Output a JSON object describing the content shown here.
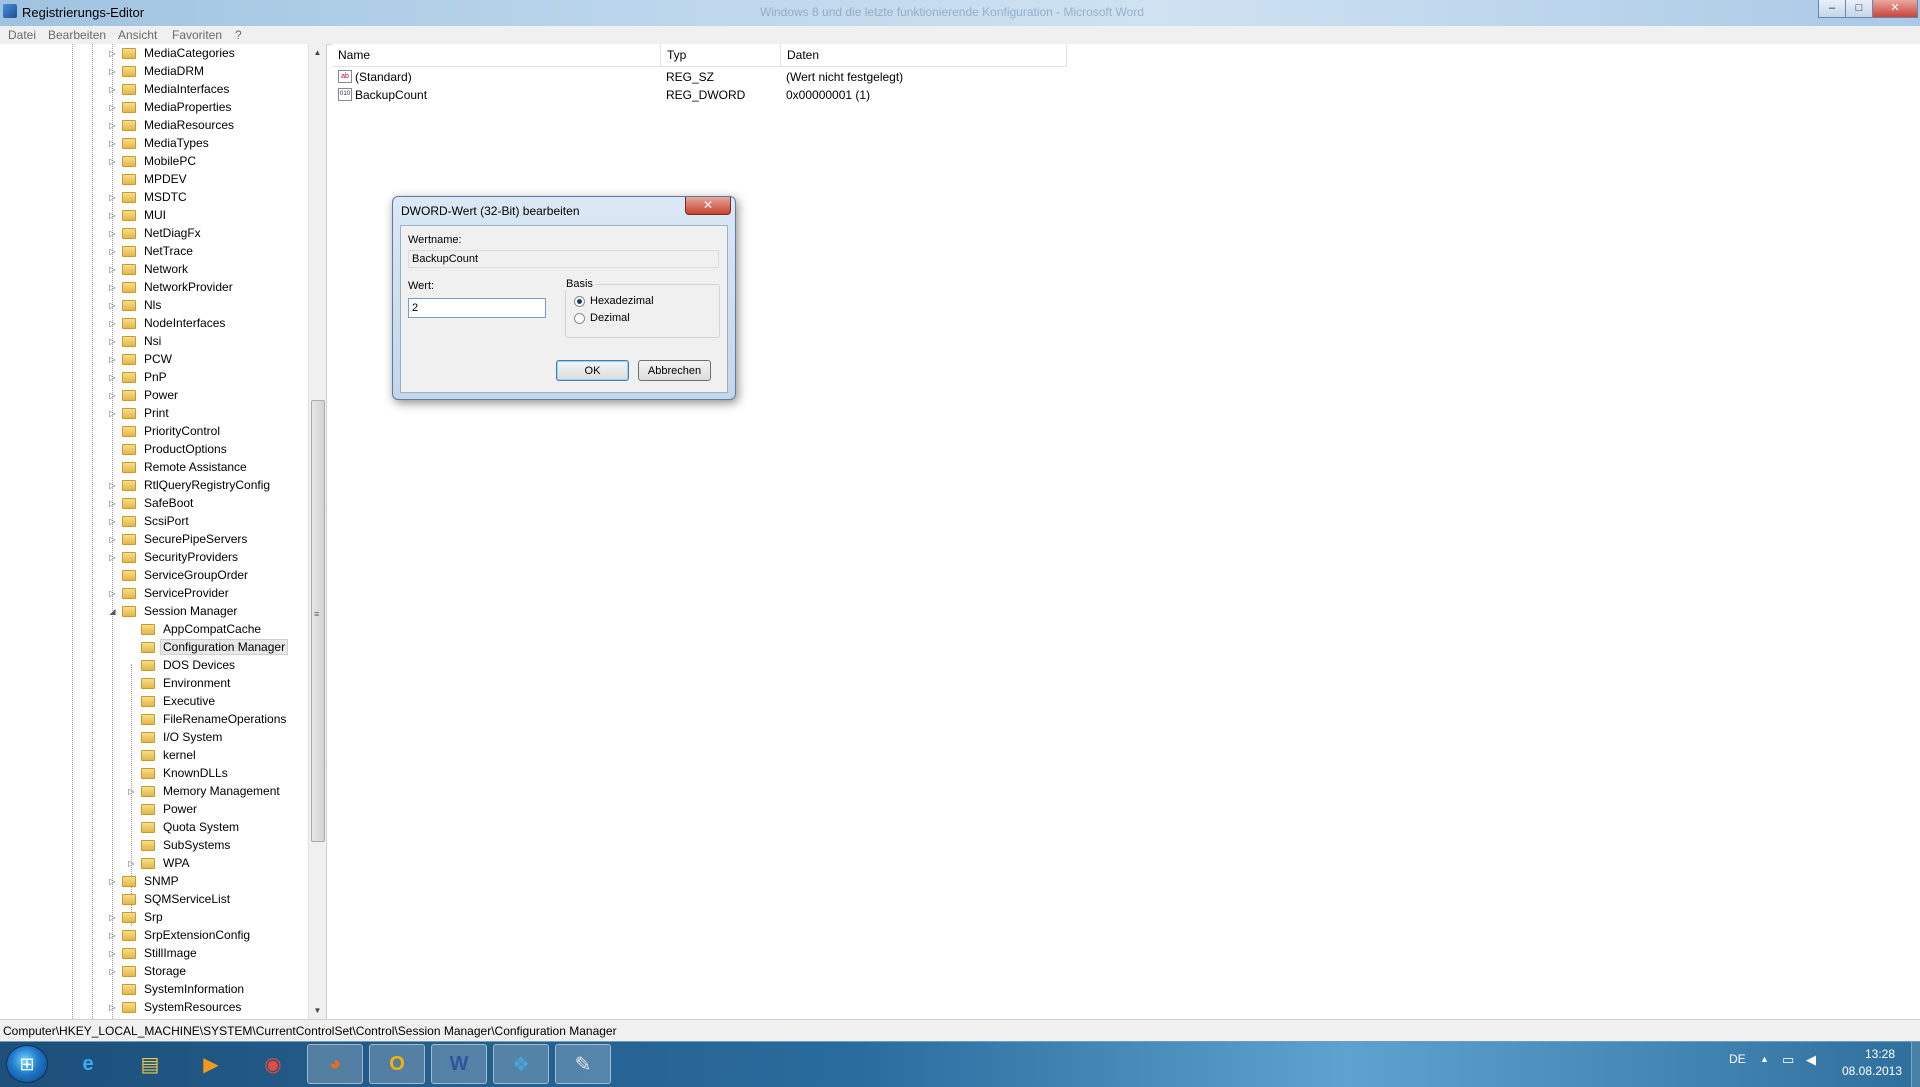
{
  "window": {
    "title": "Registrierungs-Editor",
    "ghost_title": "Windows 8 und die letzte funktionierende Konfiguration - Microsoft Word",
    "minimize": "–",
    "maximize": "□",
    "close": "✕"
  },
  "menu": [
    "Datei",
    "Bearbeiten",
    "Ansicht",
    "Favoriten",
    "?"
  ],
  "tree": {
    "level1": [
      {
        "label": "MediaCategories",
        "expand": "▷"
      },
      {
        "label": "MediaDRM",
        "expand": "▷"
      },
      {
        "label": "MediaInterfaces",
        "expand": "▷"
      },
      {
        "label": "MediaProperties",
        "expand": "▷"
      },
      {
        "label": "MediaResources",
        "expand": "▷"
      },
      {
        "label": "MediaTypes",
        "expand": "▷"
      },
      {
        "label": "MobilePC",
        "expand": "▷"
      },
      {
        "label": "MPDEV",
        "expand": ""
      },
      {
        "label": "MSDTC",
        "expand": "▷"
      },
      {
        "label": "MUI",
        "expand": "▷"
      },
      {
        "label": "NetDiagFx",
        "expand": "▷"
      },
      {
        "label": "NetTrace",
        "expand": "▷"
      },
      {
        "label": "Network",
        "expand": "▷"
      },
      {
        "label": "NetworkProvider",
        "expand": "▷"
      },
      {
        "label": "Nls",
        "expand": "▷"
      },
      {
        "label": "NodeInterfaces",
        "expand": "▷"
      },
      {
        "label": "Nsi",
        "expand": "▷"
      },
      {
        "label": "PCW",
        "expand": "▷"
      },
      {
        "label": "PnP",
        "expand": "▷"
      },
      {
        "label": "Power",
        "expand": "▷"
      },
      {
        "label": "Print",
        "expand": "▷"
      },
      {
        "label": "PriorityControl",
        "expand": ""
      },
      {
        "label": "ProductOptions",
        "expand": ""
      },
      {
        "label": "Remote Assistance",
        "expand": ""
      },
      {
        "label": "RtlQueryRegistryConfig",
        "expand": "▷"
      },
      {
        "label": "SafeBoot",
        "expand": "▷"
      },
      {
        "label": "ScsiPort",
        "expand": "▷"
      },
      {
        "label": "SecurePipeServers",
        "expand": "▷"
      },
      {
        "label": "SecurityProviders",
        "expand": "▷"
      },
      {
        "label": "ServiceGroupOrder",
        "expand": ""
      },
      {
        "label": "ServiceProvider",
        "expand": "▷"
      },
      {
        "label": "Session Manager",
        "expand": "◢"
      }
    ],
    "level2": [
      {
        "label": "AppCompatCache",
        "expand": ""
      },
      {
        "label": "Configuration Manager",
        "expand": ""
      },
      {
        "label": "DOS Devices",
        "expand": ""
      },
      {
        "label": "Environment",
        "expand": ""
      },
      {
        "label": "Executive",
        "expand": ""
      },
      {
        "label": "FileRenameOperations",
        "expand": ""
      },
      {
        "label": "I/O System",
        "expand": ""
      },
      {
        "label": "kernel",
        "expand": ""
      },
      {
        "label": "KnownDLLs",
        "expand": ""
      },
      {
        "label": "Memory Management",
        "expand": "▷"
      },
      {
        "label": "Power",
        "expand": ""
      },
      {
        "label": "Quota System",
        "expand": ""
      },
      {
        "label": "SubSystems",
        "expand": ""
      },
      {
        "label": "WPA",
        "expand": "▷"
      }
    ],
    "level1_after": [
      {
        "label": "SNMP",
        "expand": "▷"
      },
      {
        "label": "SQMServiceList",
        "expand": ""
      },
      {
        "label": "Srp",
        "expand": "▷"
      },
      {
        "label": "SrpExtensionConfig",
        "expand": "▷"
      },
      {
        "label": "StillImage",
        "expand": "▷"
      },
      {
        "label": "Storage",
        "expand": "▷"
      },
      {
        "label": "SystemInformation",
        "expand": ""
      },
      {
        "label": "SystemResources",
        "expand": "▷"
      }
    ],
    "selected": "Configuration Manager",
    "scroll_up": "▲",
    "scroll_down": "▼",
    "scroll_grip": "≡"
  },
  "values": {
    "headers": {
      "name": "Name",
      "type": "Typ",
      "data": "Daten"
    },
    "rows": [
      {
        "icon": "ab",
        "name": "(Standard)",
        "type": "REG_SZ",
        "data": "(Wert nicht festgelegt)"
      },
      {
        "icon": "010",
        "name": "BackupCount",
        "type": "REG_DWORD",
        "data": "0x00000001 (1)"
      }
    ]
  },
  "dialog": {
    "title": "DWORD-Wert (32-Bit) bearbeiten",
    "close": "✕",
    "wertname_label": "Wertname:",
    "wertname_value": "BackupCount",
    "wert_label": "Wert:",
    "wert_value": "2",
    "basis_label": "Basis",
    "hex_label": "Hexadezimal",
    "dec_label": "Dezimal",
    "ok": "OK",
    "cancel": "Abbrechen"
  },
  "status": {
    "path": "Computer\\HKEY_LOCAL_MACHINE\\SYSTEM\\CurrentControlSet\\Control\\Session Manager\\Configuration Manager"
  },
  "taskbar": {
    "start_glyph": "⊞",
    "apps": [
      {
        "name": "internet-explorer",
        "glyph": "e",
        "color": "#3fa9f5",
        "active": false
      },
      {
        "name": "file-explorer",
        "glyph": "▤",
        "color": "#f2c744",
        "active": false
      },
      {
        "name": "media-player",
        "glyph": "▶",
        "color": "#f39a1e",
        "active": false
      },
      {
        "name": "chrome",
        "glyph": "◉",
        "color": "#e94b3c",
        "active": false
      },
      {
        "name": "firefox",
        "glyph": "◕",
        "color": "#f06a1a",
        "active": true
      },
      {
        "name": "outlook",
        "glyph": "O",
        "color": "#f4b400",
        "active": true
      },
      {
        "name": "word",
        "glyph": "W",
        "color": "#2b579a",
        "active": true
      },
      {
        "name": "registry-editor",
        "glyph": "❖",
        "color": "#4aa3d8",
        "active": true
      },
      {
        "name": "paint",
        "glyph": "✎",
        "color": "#e8e8e8",
        "active": true
      }
    ],
    "lang": "DE",
    "tray_arrow": "▲",
    "net_glyph": "▭",
    "vol_glyph": "◀",
    "time": "13:28",
    "date": "08.08.2013"
  }
}
